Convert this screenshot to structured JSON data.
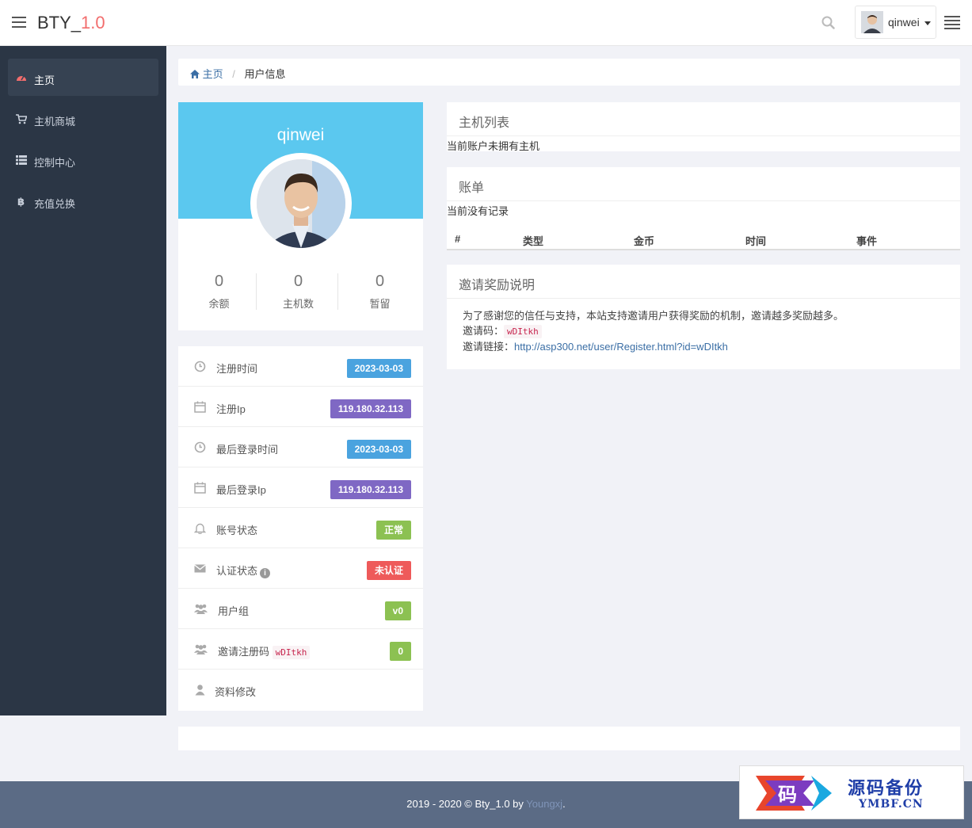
{
  "header": {
    "brand_main": "BTY_",
    "brand_version": "1.0",
    "username": "qinwei"
  },
  "sidebar": {
    "items": [
      {
        "label": "主页",
        "icon": "dashboard-icon",
        "active": true
      },
      {
        "label": "主机商城",
        "icon": "cart-icon",
        "active": false
      },
      {
        "label": "控制中心",
        "icon": "list-icon",
        "active": false
      },
      {
        "label": "充值兑换",
        "icon": "bitcoin-icon",
        "active": false
      }
    ]
  },
  "breadcrumb": {
    "home": "主页",
    "separator": "/",
    "current": "用户信息"
  },
  "profile": {
    "name": "qinwei",
    "stats": [
      {
        "value": "0",
        "label": "余额"
      },
      {
        "value": "0",
        "label": "主机数"
      },
      {
        "value": "0",
        "label": "暂留"
      }
    ]
  },
  "info": {
    "rows": [
      {
        "label": "注册时间",
        "value": "2023-03-03",
        "icon": "clock-icon",
        "color": "#4aa3df"
      },
      {
        "label": "注册Ip",
        "value": "119.180.32.113",
        "icon": "calendar-icon",
        "color": "#7f68c4"
      },
      {
        "label": "最后登录时间",
        "value": "2023-03-03",
        "icon": "clock-icon",
        "color": "#4aa3df"
      },
      {
        "label": "最后登录Ip",
        "value": "119.180.32.113",
        "icon": "calendar-icon",
        "color": "#7f68c4"
      },
      {
        "label": "账号状态",
        "value": "正常",
        "icon": "bell-icon",
        "color": "#8cc152"
      },
      {
        "label": "认证状态",
        "value": "未认证",
        "icon": "envelope-icon",
        "color": "#ee5a5a",
        "info_icon": "i"
      },
      {
        "label": "用户组",
        "value": "v0",
        "icon": "users-icon",
        "color": "#8cc152"
      },
      {
        "label": "邀请注册码",
        "code": "wDItkh",
        "value": "0",
        "icon": "users-icon",
        "color": "#8cc152"
      },
      {
        "label": "资料修改",
        "icon": "user-icon"
      }
    ]
  },
  "hosts": {
    "title": "主机列表",
    "note": "当前账户未拥有主机"
  },
  "bills": {
    "title": "账单",
    "note": "当前没有记录",
    "columns": [
      "#",
      "类型",
      "金币",
      "时间",
      "事件"
    ]
  },
  "invite": {
    "title": "邀请奖励说明",
    "desc": "为了感谢您的信任与支持，本站支持邀请用户获得奖励的机制，邀请越多奖励越多。",
    "code_label": "邀请码：",
    "code": "wDItkh",
    "link_label": "邀请链接：",
    "link": "http://asp300.net/user/Register.html?id=wDItkh"
  },
  "footer": {
    "text": "2019 - 2020 © Bty_1.0 by ",
    "author": "Youngxj",
    "end": "."
  },
  "watermark": {
    "mark_char": "码",
    "cn": "源码备份",
    "en": "YMBF.CN"
  },
  "colors": {
    "accent": "#5bc8ef",
    "sidebar": "#2b3645",
    "brand_version": "#f26d6d",
    "footer": "#5b6b85"
  }
}
